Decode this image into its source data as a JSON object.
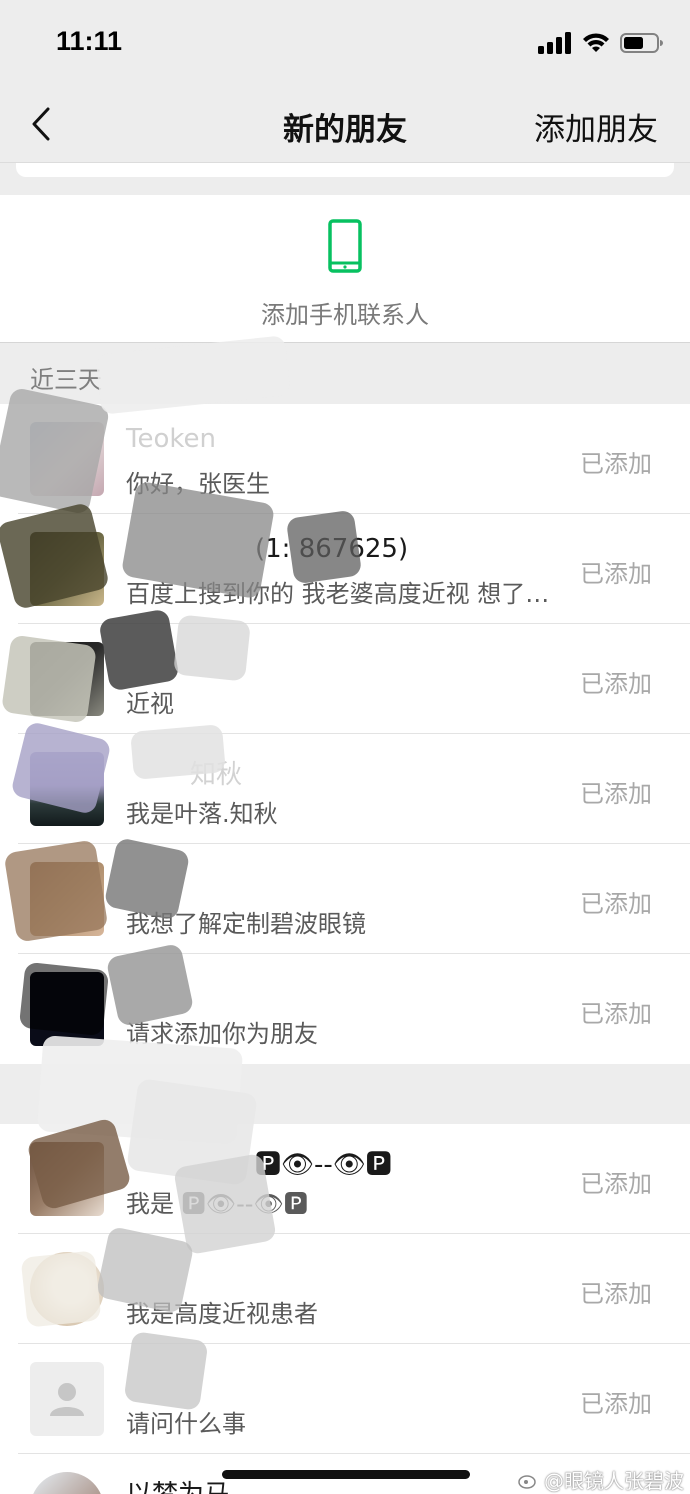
{
  "status_bar": {
    "time": "11:11"
  },
  "nav": {
    "title": "新的朋友",
    "action_label": "添加朋友"
  },
  "add_phone": {
    "label": "添加手机联系人",
    "icon": "mobile-phone-icon",
    "accent": "#07c160"
  },
  "sections": [
    {
      "header": "近三天",
      "items": [
        {
          "name": "Teoken",
          "message": "你好，张医生",
          "status": "已添加"
        },
        {
          "name": "(1: 867625)",
          "message": "百度上搜到你的 我老婆高度近视 想了解一下",
          "status": "已添加"
        },
        {
          "name": "",
          "message": "近视",
          "status": "已添加"
        },
        {
          "name": "知秋",
          "message": "我是叶落.知秋",
          "status": "已添加"
        },
        {
          "name": "",
          "message": "我想了解定制碧波眼镜",
          "status": "已添加"
        },
        {
          "name": "",
          "message": "请求添加你为朋友",
          "status": "已添加"
        }
      ]
    },
    {
      "header": "",
      "items": [
        {
          "name": "🅿👁--👁🅿",
          "message": "我是 🅿👁--👁🅿",
          "status": "已添加"
        },
        {
          "name": "",
          "message": "我是高度近视患者",
          "status": "已添加"
        },
        {
          "name": "",
          "message": "请问什么事",
          "status": "已添加"
        },
        {
          "name": "以梦为马",
          "message": "",
          "status": ""
        }
      ]
    }
  ],
  "watermark": "@眼镜人张碧波"
}
